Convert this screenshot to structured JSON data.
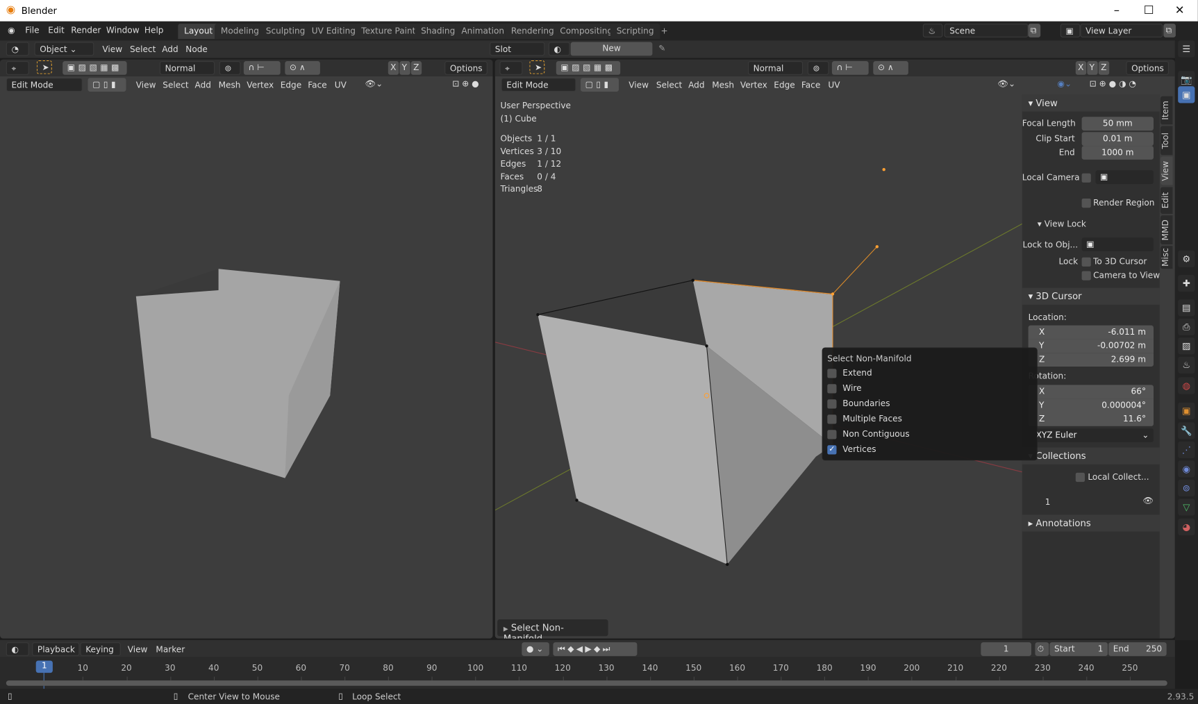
{
  "window": {
    "title": "Blender",
    "controls": [
      "–",
      "☐",
      "✕"
    ]
  },
  "menu": [
    "File",
    "Edit",
    "Render",
    "Window",
    "Help"
  ],
  "workspaces": [
    "Layout",
    "Modeling",
    "Sculpting",
    "UV Editing",
    "Texture Paint",
    "Shading",
    "Animation",
    "Rendering",
    "Compositing",
    "Scripting",
    "+"
  ],
  "active_workspace": "Layout",
  "scene": {
    "scene_name": "Scene",
    "view_layer": "View Layer"
  },
  "node_header": {
    "object_mode": "Object",
    "menus": [
      "View",
      "Select",
      "Add",
      "Node"
    ],
    "slot": "Slot",
    "new_label": "New"
  },
  "left_view": {
    "orientation": "Normal",
    "options": "Options",
    "mode": "Edit Mode",
    "menus": [
      "View",
      "Select",
      "Add",
      "Mesh",
      "Vertex",
      "Edge",
      "Face",
      "UV"
    ],
    "axes": [
      "X",
      "Y",
      "Z"
    ]
  },
  "right_view": {
    "orientation": "Normal",
    "options": "Options",
    "mode": "Edit Mode",
    "menus": [
      "View",
      "Select",
      "Add",
      "Mesh",
      "Vertex",
      "Edge",
      "Face",
      "UV"
    ],
    "axes": [
      "X",
      "Y",
      "Z"
    ],
    "overlay": {
      "perspective": "User Perspective",
      "object": "(1) Cube",
      "stats": [
        {
          "k": "Objects",
          "v": "1 / 1"
        },
        {
          "k": "Vertices",
          "v": "3 / 10"
        },
        {
          "k": "Edges",
          "v": "1 / 12"
        },
        {
          "k": "Faces",
          "v": "0 / 4"
        },
        {
          "k": "Triangles",
          "v": "8"
        }
      ]
    },
    "last_op": "Select Non-Manifold"
  },
  "popup": {
    "title": "Select Non-Manifold",
    "options": [
      {
        "label": "Extend",
        "checked": false
      },
      {
        "label": "Wire",
        "checked": false
      },
      {
        "label": "Boundaries",
        "checked": false
      },
      {
        "label": "Multiple Faces",
        "checked": false
      },
      {
        "label": "Non Contiguous",
        "checked": false
      },
      {
        "label": "Vertices",
        "checked": true
      }
    ]
  },
  "sidebar": {
    "tabs": [
      "Item",
      "Tool",
      "View",
      "Edit",
      "MMD",
      "Misc"
    ],
    "active_tab": "View",
    "view": {
      "title": "View",
      "focal_label": "Focal Length",
      "focal": "50 mm",
      "clip_start_label": "Clip Start",
      "clip_start": "0.01 m",
      "end_label": "End",
      "end": "1000 m",
      "local_camera": "Local Camera",
      "render_region": "Render Region"
    },
    "view_lock": {
      "title": "View Lock",
      "lock_obj": "Lock to Obj...",
      "lock": "Lock",
      "to_cursor": "To 3D Cursor",
      "camera_to_view": "Camera to View"
    },
    "cursor": {
      "title": "3D Cursor",
      "location": "Location:",
      "loc": [
        {
          "a": "X",
          "v": "-6.011 m"
        },
        {
          "a": "Y",
          "v": "-0.00702 m"
        },
        {
          "a": "Z",
          "v": "2.699 m"
        }
      ],
      "rotation": "Rotation:",
      "rot": [
        {
          "a": "X",
          "v": "66°"
        },
        {
          "a": "Y",
          "v": "0.000004°"
        },
        {
          "a": "Z",
          "v": "11.6°"
        }
      ],
      "mode": "XYZ Euler"
    },
    "collections": {
      "title": "Collections",
      "local": "Local Collect...",
      "item": "1"
    },
    "annotations": {
      "title": "Annotations"
    }
  },
  "timeline": {
    "menus": [
      "Playback",
      "Keying",
      "View",
      "Marker"
    ],
    "current": "1",
    "start_label": "Start",
    "start": "1",
    "end_label": "End",
    "end": "250",
    "ticks": [
      "10",
      "20",
      "30",
      "40",
      "50",
      "60",
      "70",
      "80",
      "90",
      "100",
      "110",
      "120",
      "130",
      "140",
      "150",
      "160",
      "170",
      "180",
      "190",
      "200",
      "210",
      "220",
      "230",
      "240",
      "250"
    ]
  },
  "status": {
    "hint1": "Center View to Mouse",
    "hint2": "Loop Select",
    "version": "2.93.5"
  },
  "colors": {
    "accent": "#4772b3",
    "selected": "#ffa033",
    "viewport": "#3d3d3d"
  }
}
